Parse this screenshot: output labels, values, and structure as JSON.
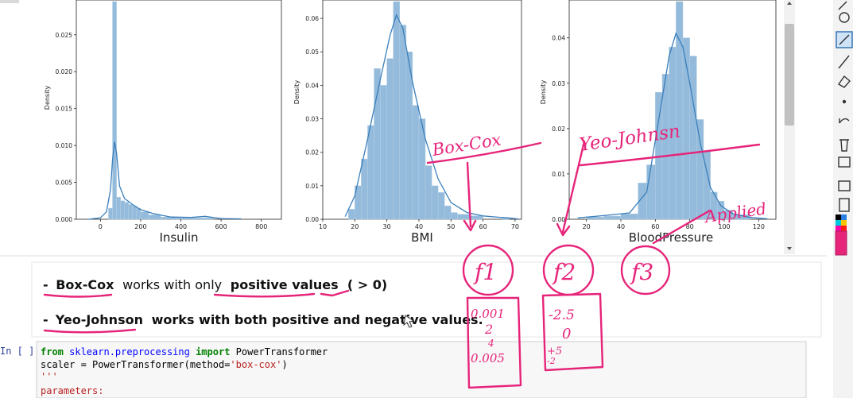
{
  "charts": [
    {
      "chart_data": {
        "type": "histogram",
        "xlabel": "Insulin",
        "ylabel": "Density",
        "xticks": [
          "0",
          "200",
          "400",
          "600",
          "800"
        ],
        "yticks": [
          "0.000",
          "0.005",
          "0.010",
          "0.015",
          "0.020",
          "0.025"
        ],
        "xlim": [
          -120,
          900
        ],
        "ylim": [
          0,
          0.0295
        ],
        "bins": [
          {
            "x0": 40,
            "x1": 60,
            "density": 0.0015
          },
          {
            "x0": 60,
            "x1": 80,
            "density": 0.0295
          },
          {
            "x0": 80,
            "x1": 100,
            "density": 0.003
          },
          {
            "x0": 100,
            "x1": 120,
            "density": 0.0025
          },
          {
            "x0": 120,
            "x1": 140,
            "density": 0.0023
          },
          {
            "x0": 140,
            "x1": 160,
            "density": 0.002
          },
          {
            "x0": 160,
            "x1": 180,
            "density": 0.0018
          },
          {
            "x0": 180,
            "x1": 200,
            "density": 0.0015
          },
          {
            "x0": 200,
            "x1": 240,
            "density": 0.001
          },
          {
            "x0": 240,
            "x1": 300,
            "density": 0.0006
          },
          {
            "x0": 300,
            "x1": 380,
            "density": 0.0003
          },
          {
            "x0": 380,
            "x1": 480,
            "density": 0.0002
          },
          {
            "x0": 480,
            "x1": 560,
            "density": 0.0002
          }
        ],
        "kde": [
          [
            -60,
            0
          ],
          [
            0,
            0.0002
          ],
          [
            30,
            0.001
          ],
          [
            50,
            0.004
          ],
          [
            60,
            0.008
          ],
          [
            70,
            0.0105
          ],
          [
            80,
            0.009
          ],
          [
            95,
            0.0045
          ],
          [
            120,
            0.0028
          ],
          [
            160,
            0.002
          ],
          [
            200,
            0.0013
          ],
          [
            260,
            0.0008
          ],
          [
            350,
            0.0003
          ],
          [
            450,
            0.00025
          ],
          [
            520,
            0.0004
          ],
          [
            600,
            0.0001
          ],
          [
            700,
            5e-05
          ]
        ]
      }
    },
    {
      "chart_data": {
        "type": "histogram",
        "xlabel": "BMI",
        "ylabel": "Density",
        "xticks": [
          "10",
          "20",
          "30",
          "40",
          "50",
          "60",
          "70"
        ],
        "yticks": [
          "0.00",
          "0.01",
          "0.02",
          "0.03",
          "0.04",
          "0.05",
          "0.06"
        ],
        "xlim": [
          10,
          72
        ],
        "ylim": [
          0,
          0.065
        ],
        "bins": [
          {
            "x0": 18,
            "x1": 20,
            "density": 0.003
          },
          {
            "x0": 20,
            "x1": 22,
            "density": 0.01
          },
          {
            "x0": 22,
            "x1": 24,
            "density": 0.018
          },
          {
            "x0": 24,
            "x1": 26,
            "density": 0.028
          },
          {
            "x0": 26,
            "x1": 28,
            "density": 0.045
          },
          {
            "x0": 28,
            "x1": 30,
            "density": 0.04
          },
          {
            "x0": 30,
            "x1": 32,
            "density": 0.048
          },
          {
            "x0": 32,
            "x1": 34,
            "density": 0.065
          },
          {
            "x0": 34,
            "x1": 36,
            "density": 0.058
          },
          {
            "x0": 36,
            "x1": 38,
            "density": 0.05
          },
          {
            "x0": 38,
            "x1": 40,
            "density": 0.034
          },
          {
            "x0": 40,
            "x1": 42,
            "density": 0.03
          },
          {
            "x0": 42,
            "x1": 44,
            "density": 0.016
          },
          {
            "x0": 44,
            "x1": 46,
            "density": 0.01
          },
          {
            "x0": 46,
            "x1": 48,
            "density": 0.008
          },
          {
            "x0": 48,
            "x1": 50,
            "density": 0.004
          },
          {
            "x0": 50,
            "x1": 52,
            "density": 0.002
          },
          {
            "x0": 52,
            "x1": 56,
            "density": 0.0015
          },
          {
            "x0": 56,
            "x1": 60,
            "density": 0.001
          },
          {
            "x0": 66,
            "x1": 68,
            "density": 0.0005
          }
        ],
        "kde": [
          [
            17,
            0.0008
          ],
          [
            20,
            0.007
          ],
          [
            24,
            0.024
          ],
          [
            28,
            0.042
          ],
          [
            31,
            0.055
          ],
          [
            33,
            0.061
          ],
          [
            35,
            0.057
          ],
          [
            38,
            0.041
          ],
          [
            42,
            0.024
          ],
          [
            46,
            0.012
          ],
          [
            50,
            0.005
          ],
          [
            55,
            0.002
          ],
          [
            60,
            0.001
          ],
          [
            65,
            0.0006
          ],
          [
            68,
            0.0004
          ],
          [
            71,
            0.0001
          ]
        ]
      }
    },
    {
      "chart_data": {
        "type": "histogram",
        "xlabel": "BloodPressure",
        "ylabel": "Density",
        "xticks": [
          "20",
          "40",
          "60",
          "80",
          "100",
          "120"
        ],
        "yticks": [
          "0.00",
          "0.01",
          "0.02",
          "0.03",
          "0.04"
        ],
        "xlim": [
          10,
          130
        ],
        "ylim": [
          0,
          0.048
        ],
        "bins": [
          {
            "x0": 20,
            "x1": 30,
            "density": 0.0005
          },
          {
            "x0": 30,
            "x1": 40,
            "density": 0.0007
          },
          {
            "x0": 40,
            "x1": 50,
            "density": 0.0012
          },
          {
            "x0": 50,
            "x1": 55,
            "density": 0.008
          },
          {
            "x0": 55,
            "x1": 60,
            "density": 0.012
          },
          {
            "x0": 60,
            "x1": 64,
            "density": 0.028
          },
          {
            "x0": 64,
            "x1": 68,
            "density": 0.032
          },
          {
            "x0": 68,
            "x1": 72,
            "density": 0.038
          },
          {
            "x0": 72,
            "x1": 76,
            "density": 0.048
          },
          {
            "x0": 76,
            "x1": 80,
            "density": 0.04
          },
          {
            "x0": 80,
            "x1": 84,
            "density": 0.036
          },
          {
            "x0": 84,
            "x1": 88,
            "density": 0.022
          },
          {
            "x0": 88,
            "x1": 92,
            "density": 0.015
          },
          {
            "x0": 92,
            "x1": 96,
            "density": 0.006
          },
          {
            "x0": 96,
            "x1": 100,
            "density": 0.004
          },
          {
            "x0": 100,
            "x1": 105,
            "density": 0.002
          },
          {
            "x0": 105,
            "x1": 115,
            "density": 0.001
          }
        ],
        "kde": [
          [
            15,
            0.0003
          ],
          [
            30,
            0.0008
          ],
          [
            45,
            0.0014
          ],
          [
            55,
            0.006
          ],
          [
            62,
            0.022
          ],
          [
            68,
            0.036
          ],
          [
            72,
            0.041
          ],
          [
            76,
            0.038
          ],
          [
            80,
            0.03
          ],
          [
            86,
            0.017
          ],
          [
            92,
            0.007
          ],
          [
            98,
            0.003
          ],
          [
            105,
            0.0012
          ],
          [
            115,
            0.0004
          ],
          [
            125,
            0.0001
          ]
        ]
      }
    }
  ],
  "markdown": {
    "line1": {
      "dash": "-",
      "name": "Box-Cox",
      "mid": " works with only ",
      "pos": "positive values",
      "rest": " ( > 0)"
    },
    "line2": {
      "dash": "-",
      "name": "Yeo-Johnson",
      "text": " works with both positive and negative values."
    }
  },
  "code_cell": {
    "prompt": "In [ ]:",
    "line1": {
      "kw": "from",
      "mod": " sklearn.preprocessing ",
      "kw2": "import",
      "cls": " PowerTransformer"
    },
    "line2": {
      "pre": "scaler = PowerTransformer(method=",
      "str": "'box-cox'",
      "post": ")"
    },
    "line3": "'''",
    "line4": "parameters:"
  },
  "annotations": {
    "boxcox": "Box-Cox",
    "yeojohnson": "Yeo-Johnsn",
    "applied": "Applied",
    "f1": "f1",
    "f2": "f2",
    "f3": "f3",
    "vals1": [
      "0.001",
      "2",
      "4",
      "0.005"
    ],
    "vals2": [
      "-2.5",
      "0",
      "+5",
      "-2"
    ]
  },
  "colors": {
    "bar": "#94bbdb",
    "bar_edge": "#b4cfe6",
    "kde": "#3b7fbb",
    "ink": "#e6247a",
    "code_bg": "#f7f7f7",
    "keyword": "#008000",
    "string": "#ba2121",
    "doc": "#ba2121"
  }
}
